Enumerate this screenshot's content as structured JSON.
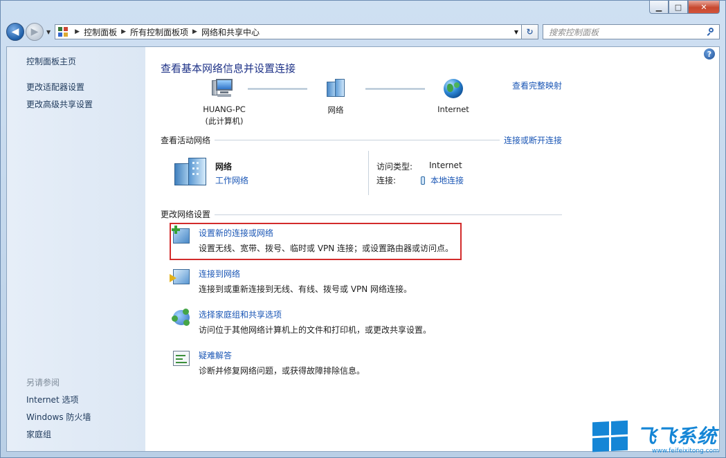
{
  "window": {
    "controls": {
      "minimize": "▁",
      "maximize": "□",
      "close": "✕"
    }
  },
  "nav": {
    "back_glyph": "◀",
    "forward_glyph": "▶",
    "breadcrumb": [
      "控制面板",
      "所有控制面板项",
      "网络和共享中心"
    ],
    "search_placeholder": "搜索控制面板"
  },
  "sidebar": {
    "home": "控制面板主页",
    "items": [
      "更改适配器设置",
      "更改高级共享设置"
    ],
    "see_also_title": "另请参阅",
    "see_also": [
      "Internet 选项",
      "Windows 防火墙",
      "家庭组"
    ]
  },
  "main": {
    "help": "?",
    "title": "查看基本网络信息并设置连接",
    "full_map_link": "查看完整映射",
    "map": {
      "computer_name": "HUANG-PC",
      "computer_note": "(此计算机)",
      "network": "网络",
      "internet": "Internet"
    },
    "active_section": {
      "title": "查看活动网络",
      "connect_link": "连接或断开连接",
      "network_name": "网络",
      "network_type": "工作网络",
      "access_type_label": "访问类型:",
      "access_type_value": "Internet",
      "connections_label": "连接:",
      "connections_value": "本地连接"
    },
    "change_section": {
      "title": "更改网络设置",
      "tasks": [
        {
          "title": "设置新的连接或网络",
          "desc": "设置无线、宽带、拨号、临时或 VPN 连接；或设置路由器或访问点。",
          "icon": "new-connection-icon"
        },
        {
          "title": "连接到网络",
          "desc": "连接到或重新连接到无线、有线、拨号或 VPN 网络连接。",
          "icon": "connect-network-icon"
        },
        {
          "title": "选择家庭组和共享选项",
          "desc": "访问位于其他网络计算机上的文件和打印机，或更改共享设置。",
          "icon": "homegroup-icon"
        },
        {
          "title": "疑难解答",
          "desc": "诊断并修复网络问题，或获得故障排除信息。",
          "icon": "troubleshoot-icon"
        }
      ]
    }
  },
  "watermark": {
    "name": "飞飞系统",
    "url": "www.feifeixitong.com"
  },
  "colors": {
    "link": "#1a56b5",
    "title": "#1e3287",
    "highlight": "#d32b2b",
    "brand": "#1586d6"
  }
}
